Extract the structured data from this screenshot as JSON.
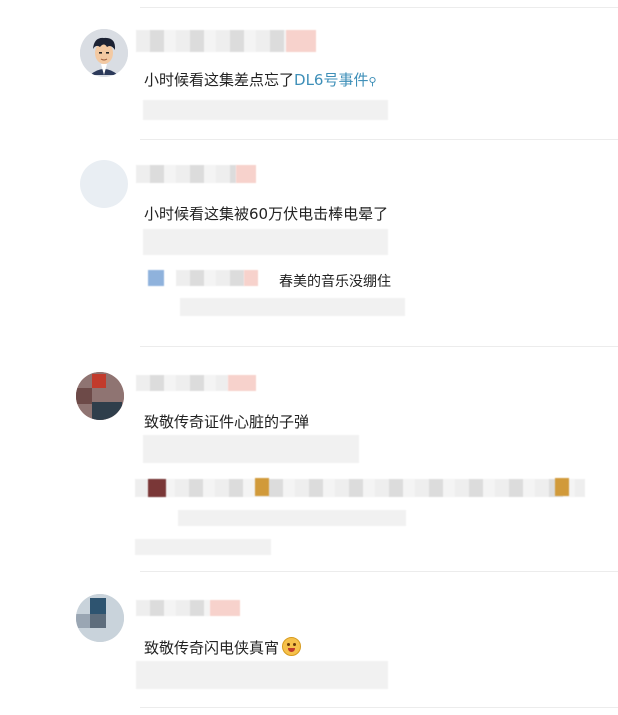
{
  "comments": [
    {
      "text": "小时候看这集差点忘了",
      "link_text": "DL6号事件",
      "link_icon": "search-icon"
    },
    {
      "text": "小时候看这集被60万伏电击棒电晕了",
      "reply_text": "春美的音乐没绷住"
    },
    {
      "text": "致敬传奇证件心脏的子弹"
    },
    {
      "text": "致敬传奇闪电侠真宵",
      "emoji": "fearful-face-icon"
    }
  ]
}
